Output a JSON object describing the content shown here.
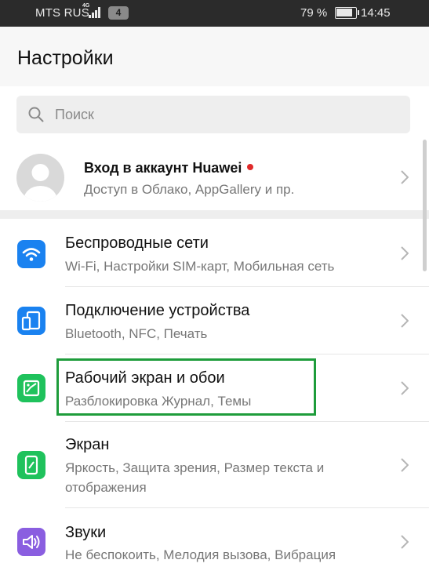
{
  "status_bar": {
    "carrier": "MTS RUS",
    "network": "4G",
    "sim_badge": "4",
    "battery_percent": "79 %",
    "time": "14:45"
  },
  "header": {
    "title": "Настройки"
  },
  "search": {
    "placeholder": "Поиск"
  },
  "account": {
    "title": "Вход в аккаунт Huawei",
    "subtitle": "Доступ в Облако, AppGallery и пр."
  },
  "settings": [
    {
      "title": "Беспроводные сети",
      "subtitle": "Wi-Fi, Настройки SIM-карт, Мобильная сеть",
      "icon": "wifi-icon",
      "color": "#1a82f0"
    },
    {
      "title": "Подключение устройства",
      "subtitle": "Bluetooth, NFC, Печать",
      "icon": "device-connection-icon",
      "color": "#1a82f0"
    },
    {
      "title": "Рабочий экран и обои",
      "subtitle": "Разблокировка Журнал, Темы",
      "icon": "wallpaper-icon",
      "color": "#1fc25c"
    },
    {
      "title": "Экран",
      "subtitle": "Яркость, Защита зрения, Размер текста и отображения",
      "icon": "display-icon",
      "color": "#1fc25c"
    },
    {
      "title": "Звуки",
      "subtitle": "Не беспокоить, Мелодия вызова, Вибрация",
      "icon": "sound-icon",
      "color": "#8a5ee0"
    }
  ],
  "highlight_color": "#1e9c3b"
}
